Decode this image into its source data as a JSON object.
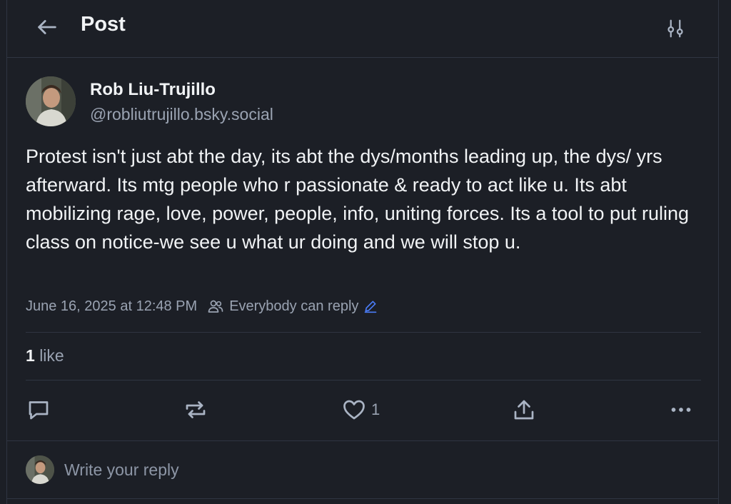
{
  "header": {
    "title": "Post"
  },
  "post": {
    "author_name": "Rob Liu-Trujillo",
    "author_handle": "@robliutrujillo.bsky.social",
    "text": "Protest isn't just abt the day, its abt the dys/months leading up, the dys/ yrs afterward. Its mtg people who r passionate & ready to act like u. Its abt mobilizing rage, love, power, people, info, uniting forces. Its a tool to put ruling class on notice-we see u what ur doing and we will stop u.",
    "timestamp": "June 16, 2025 at 12:48 PM",
    "reply_setting": "Everybody can reply",
    "like_count": "1",
    "like_label": "like"
  },
  "actions": {
    "like_count": "1"
  },
  "reply": {
    "placeholder": "Write your reply"
  },
  "colors": {
    "background": "#1c1f26",
    "border": "#2f3542",
    "text": "#f1f3f5",
    "muted": "#9aa3b2",
    "accent": "#4a7cf7"
  },
  "icons": [
    "arrow-left-icon",
    "sliders-icon",
    "people-icon",
    "pencil-icon",
    "comment-icon",
    "repost-icon",
    "heart-icon",
    "share-icon",
    "more-icon"
  ]
}
